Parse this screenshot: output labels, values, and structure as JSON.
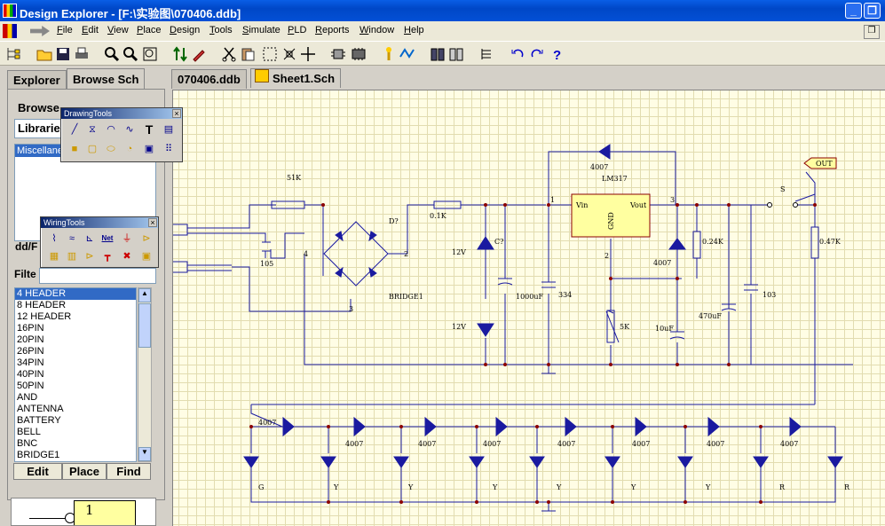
{
  "window": {
    "title": "Design Explorer - [F:\\实验图\\070406.ddb]"
  },
  "menu": [
    "File",
    "Edit",
    "View",
    "Place",
    "Design",
    "Tools",
    "Simulate",
    "PLD",
    "Reports",
    "Window",
    "Help"
  ],
  "panel_tabs": [
    "Explorer",
    "Browse Sch"
  ],
  "browse": {
    "label": "Browse",
    "dropdown": "Libraries",
    "library": "Miscellaneous",
    "add_label": "dd/F",
    "filter_label": "Filte"
  },
  "drawing_tools": {
    "title": "DrawingTools"
  },
  "wiring_tools": {
    "title": "WiringTools"
  },
  "components": [
    "4 HEADER",
    "8 HEADER",
    "12 HEADER",
    "16PIN",
    "20PIN",
    "26PIN",
    "34PIN",
    "40PIN",
    "50PIN",
    "AND",
    "ANTENNA",
    "BATTERY",
    "BELL",
    "BNC",
    "BRIDGE1"
  ],
  "buttons": {
    "edit": "Edit",
    "place": "Place",
    "find": "Find"
  },
  "preview_pin": "1",
  "doc_tabs": [
    "070406.ddb",
    "Sheet1.Sch"
  ],
  "schematic": {
    "labels": {
      "r1": "51K",
      "c1": "105",
      "bridge_pin4": "4",
      "bridge_pin2": "2",
      "bridge_pin3": "3",
      "bridge": "BRIDGE1",
      "d_q": "D?",
      "r2": "0.1K",
      "z1": "12V",
      "z2": "12V",
      "c_q": "C?",
      "c2": "1000uF",
      "c3": "334",
      "reg": "LM317",
      "reg_vin": "Vin",
      "reg_vout": "Vout",
      "reg_gnd": "GND",
      "pin1": "1",
      "pin3": "3",
      "pin2": "2",
      "d_top": "4007",
      "d_mid": "4007",
      "r3": "0.24K",
      "pot": "5K",
      "c4": "10uF",
      "c5": "470uF",
      "c6": "103",
      "sw": "S",
      "out": "OUT",
      "r4": "0.47K"
    },
    "diode_labels": [
      "4007",
      "4007",
      "4007",
      "4007",
      "4007",
      "4007",
      "4007",
      "4007",
      "4007"
    ],
    "led_labels": [
      "G",
      "Y",
      "Y",
      "Y",
      "Y",
      "Y",
      "Y",
      "R",
      "R"
    ]
  }
}
